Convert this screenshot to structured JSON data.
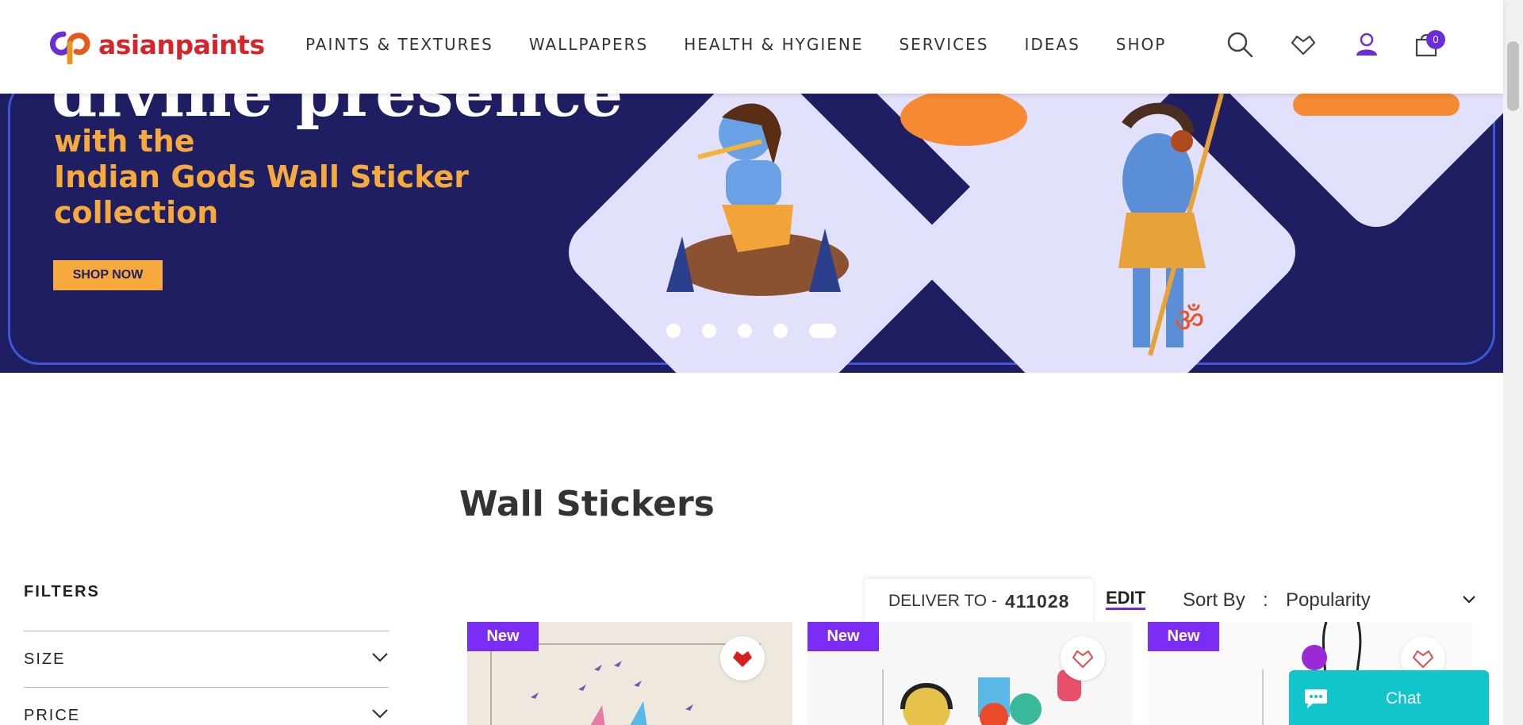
{
  "header": {
    "logo_text": "asianpaints",
    "nav": [
      "PAINTS & TEXTURES",
      "WALLPAPERS",
      "HEALTH & HYGIENE",
      "SERVICES",
      "IDEAS",
      "SHOP"
    ],
    "cart_count": "0"
  },
  "banner": {
    "top_text": "divine presence",
    "text_line1": "with the",
    "text_line2": "Indian Gods Wall Sticker",
    "text_line3": "collection",
    "cta": "SHOP NOW",
    "slide_count": 5,
    "active_slide": 5
  },
  "page": {
    "title": "Wall Stickers"
  },
  "filters": {
    "title": "FILTERS",
    "items": [
      "SIZE",
      "PRICE"
    ]
  },
  "delivery": {
    "label": "DELIVER TO -",
    "pincode": "411028",
    "edit": "EDIT"
  },
  "sort": {
    "label": "Sort By",
    "separator": ":",
    "value": "Popularity"
  },
  "products": [
    {
      "badge": "New",
      "wishlisted": true
    },
    {
      "badge": "New",
      "wishlisted": false
    },
    {
      "badge": "New",
      "wishlisted": false
    }
  ],
  "chat": {
    "label": "Chat"
  },
  "colors": {
    "brand_red": "#d6242a",
    "brand_purple": "#6a2dd6",
    "banner_bg": "#201e63",
    "banner_accent": "#f6a93c",
    "new_badge": "#7b2cf5",
    "chat_bg": "#11c5cc"
  }
}
